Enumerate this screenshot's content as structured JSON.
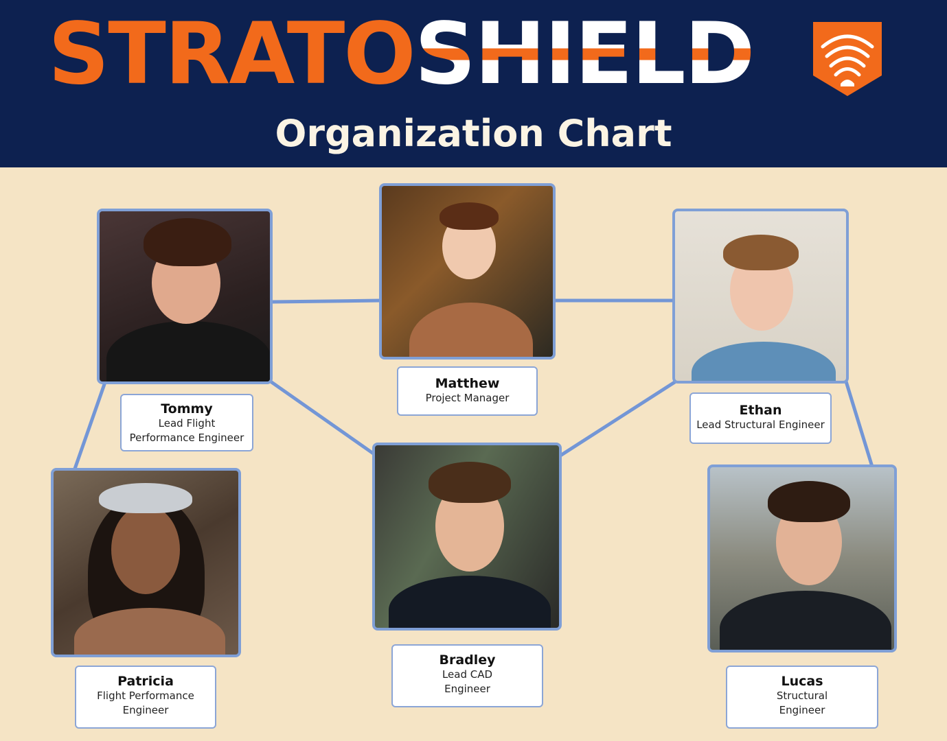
{
  "header": {
    "brand_left": "STRATO",
    "brand_right": "SHIELD",
    "subtitle": "Organization Chart"
  },
  "colors": {
    "navy": "#0d2150",
    "orange": "#f26a1b",
    "background": "#f5e4c5",
    "connector": "#7396d6"
  },
  "members": {
    "matthew": {
      "name": "Matthew",
      "role_line1": "Project Manager",
      "role_line2": ""
    },
    "tommy": {
      "name": "Tommy",
      "role_line1": "Lead Flight",
      "role_line2": "Performance Engineer"
    },
    "ethan": {
      "name": "Ethan",
      "role_line1": "Lead Structural Engineer",
      "role_line2": ""
    },
    "patricia": {
      "name": "Patricia",
      "role_line1": "Flight Performance",
      "role_line2": "Engineer"
    },
    "bradley": {
      "name": "Bradley",
      "role_line1": "Lead CAD",
      "role_line2": "Engineer"
    },
    "lucas": {
      "name": "Lucas",
      "role_line1": "Structural",
      "role_line2": "Engineer"
    }
  }
}
